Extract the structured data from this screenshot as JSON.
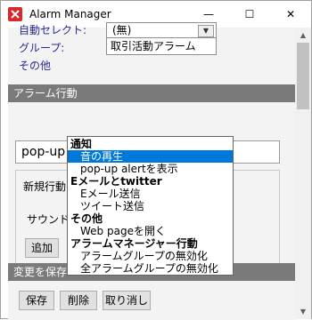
{
  "window": {
    "title": "Alarm Manager",
    "min_glyph": "—",
    "max_glyph": "☐",
    "close_glyph": "✕"
  },
  "top": {
    "partial_label": "自動セレクト:",
    "partial_value": "(無)",
    "group_label": "グループ:",
    "group_value": "取引活動アラーム",
    "other_label": "その他"
  },
  "alarm_action": {
    "header": "アラーム行動",
    "selected_value": "pop-up alertを表示",
    "new_action_label": "新規行動",
    "sound_label": "サウンド:",
    "add_button": "追加"
  },
  "dropdown": {
    "items": [
      {
        "type": "group",
        "label": "通知"
      },
      {
        "type": "option",
        "label": "音の再生",
        "selected": true
      },
      {
        "type": "option",
        "label": "pop-up alertを表示"
      },
      {
        "type": "group",
        "label": "Eメールとtwitter"
      },
      {
        "type": "option",
        "label": "Eメール送信"
      },
      {
        "type": "option",
        "label": "ツイート送信"
      },
      {
        "type": "group",
        "label": "その他"
      },
      {
        "type": "option",
        "label": "Web pageを開く"
      },
      {
        "type": "group",
        "label": "アラームマネージャー行動"
      },
      {
        "type": "option",
        "label": "アラームグループの無効化"
      },
      {
        "type": "option",
        "label": "全アラームグループの無効化"
      }
    ]
  },
  "save_section": {
    "header": "変更を保存",
    "save_button": "保存",
    "delete_button": "削除",
    "cancel_button": "取り消し"
  },
  "colors": {
    "accent": "#0078d7",
    "section_header": "#7a7a7a",
    "label_text": "#2a2a8c",
    "app_icon": "#d9272e"
  }
}
